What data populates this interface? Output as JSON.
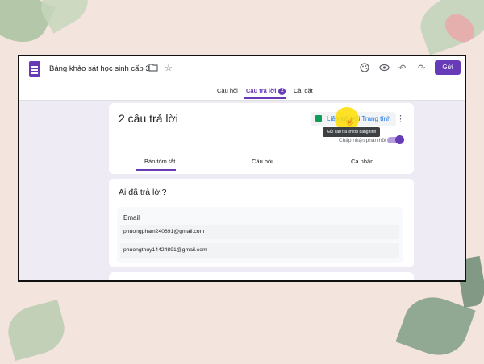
{
  "header": {
    "title": "Bảng khảo sát học sinh cấp 3",
    "send_label": "Gửi"
  },
  "tabs": [
    {
      "label": "Câu hỏi"
    },
    {
      "label": "Câu trả lời",
      "count": "2"
    },
    {
      "label": "Cài đặt"
    }
  ],
  "summary": {
    "responses_count": "2 câu trả lời",
    "link_sheets_label": "Liên kết với Trang tính",
    "tooltip": "Gửi câu trả lời tới bảng tính",
    "accept_label": "Chấp nhận phản hồi",
    "accepting": true,
    "subtabs": [
      "Bản tóm tắt",
      "Câu hỏi",
      "Cá nhân"
    ]
  },
  "who": {
    "title": "Ai đã trả lời?",
    "email_label": "Email",
    "emails": [
      "phuongpham240891@gmail.com",
      "phuongthuy14424891@gmail.com"
    ]
  },
  "colors": {
    "accent": "#673ab7",
    "background": "#efebf4",
    "sheets_green": "#0f9d58"
  },
  "icons": [
    "form-icon",
    "folder-icon",
    "star-icon",
    "palette-icon",
    "eye-icon",
    "undo-icon",
    "redo-icon",
    "sheets-icon",
    "more-icon"
  ]
}
